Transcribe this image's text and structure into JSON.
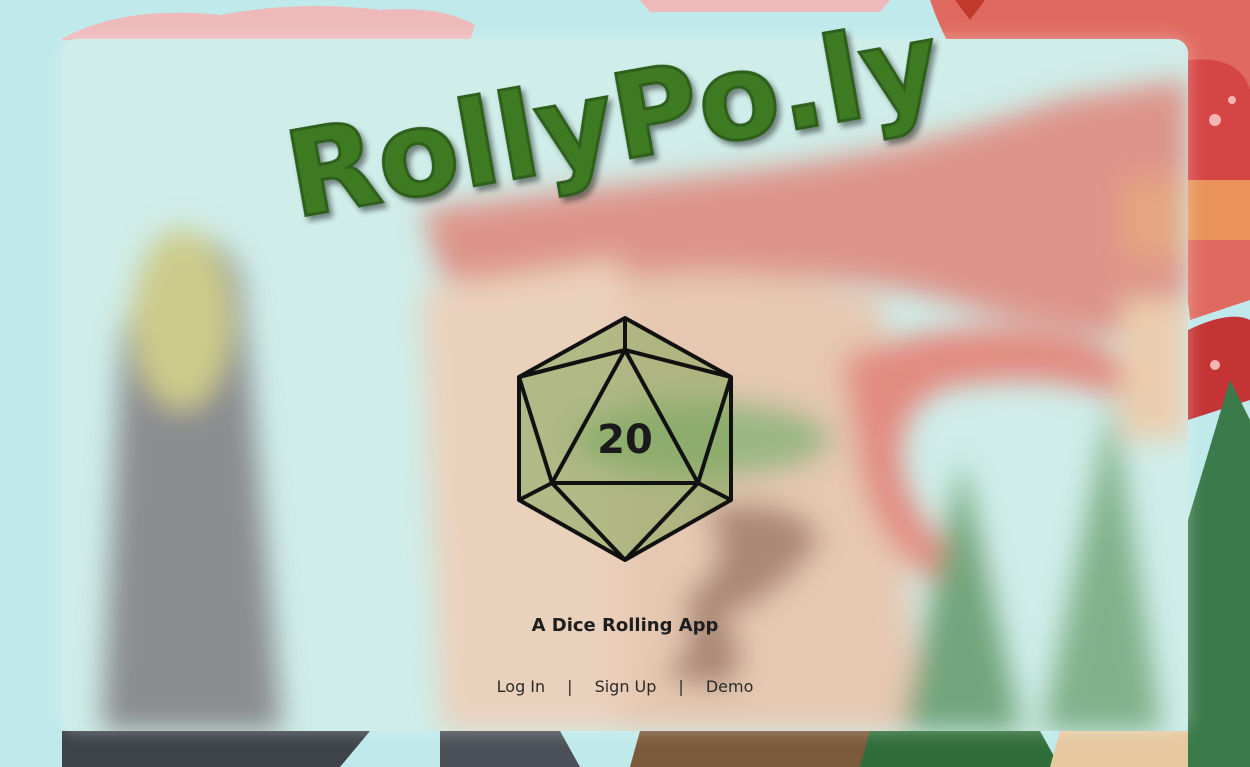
{
  "app": {
    "logo_text": "RollyPo.ly",
    "dice_value": "20",
    "tagline": "A Dice Rolling App"
  },
  "nav": {
    "login_label": "Log In",
    "signup_label": "Sign Up",
    "demo_label": "Demo",
    "separator": "|"
  },
  "icons": {
    "dice": "d20-icon"
  },
  "colors": {
    "logo_fill": "#3d7a22",
    "logo_shadow": "#1f3d12",
    "sky": "#bfe9ea",
    "dragon": "#d9534f",
    "text": "#1e1e1e"
  }
}
